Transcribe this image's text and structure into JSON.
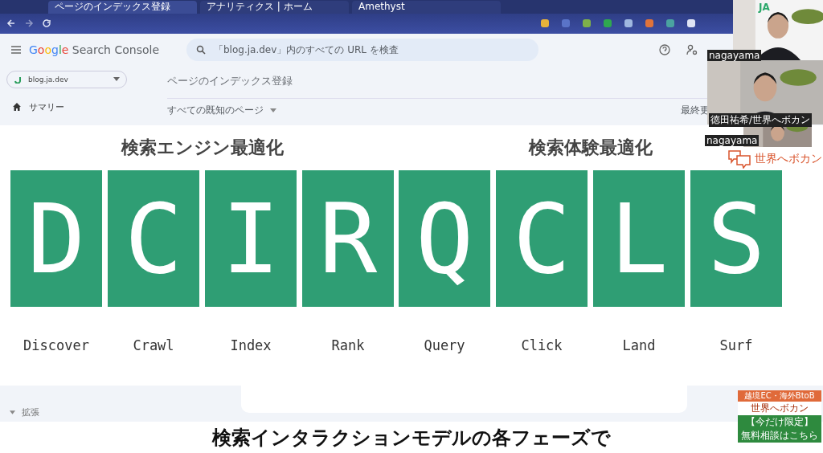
{
  "browser": {
    "tabs": [
      {
        "label": "ページのインデックス登録",
        "selected": true
      },
      {
        "label": "アナリティクス | ホーム",
        "selected": false
      },
      {
        "label": "Amethyst",
        "selected": false
      }
    ]
  },
  "console": {
    "brand": "Google",
    "product": "Search Console",
    "search": {
      "placeholder": "「blog.ja.dev」内のすべての URL を検査"
    },
    "property": "blog.ja.dev",
    "nav": [
      {
        "label": "サマリー",
        "selected": false
      }
    ],
    "heading": "ページのインデックス登録",
    "filter": "すべての既知のページ",
    "updated": "最終更",
    "section": "拡張"
  },
  "slide": {
    "groups": [
      {
        "title": "検索エンジン最適化",
        "tiles": [
          {
            "letter": "D",
            "word": "Discover"
          },
          {
            "letter": "C",
            "word": "Crawl"
          },
          {
            "letter": "I",
            "word": "Index"
          },
          {
            "letter": "R",
            "word": "Rank"
          }
        ]
      },
      {
        "title": "検索体験最適化",
        "tiles": [
          {
            "letter": "Q",
            "word": "Query"
          },
          {
            "letter": "C",
            "word": "Click"
          },
          {
            "letter": "L",
            "word": "Land"
          },
          {
            "letter": "S",
            "word": "Surf"
          }
        ]
      }
    ]
  },
  "cameras": [
    {
      "kind": "picture",
      "label": "nagayama"
    },
    {
      "kind": "picture",
      "label": "徳田祐希/世界へボカン"
    },
    {
      "kind": "picture",
      "label": "nagayama"
    }
  ],
  "logo_text": "JA",
  "brand_logo": "世界へボカン",
  "banner": {
    "top": "越境EC・海外BtoB",
    "brand": "世界へボカン",
    "tag": "【今だけ限定】",
    "cta": "無料相談はこちら"
  },
  "caption": "検索インタラクションモデルの各フェーズで"
}
